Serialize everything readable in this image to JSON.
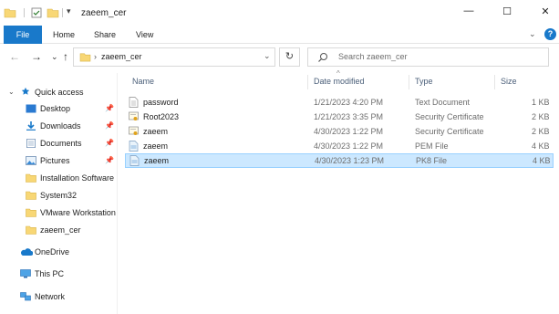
{
  "window": {
    "title": "zaeem_cer",
    "controls": {
      "minimize": "—",
      "maximize": "☐",
      "close": "✕"
    }
  },
  "ribbon": {
    "tabs": [
      "File",
      "Home",
      "Share",
      "View"
    ],
    "help": "?"
  },
  "navigation": {
    "back": "←",
    "forward": "→",
    "recent": "⌄",
    "up": "↑",
    "breadcrumb_sep": "›",
    "address": "zaeem_cer",
    "address_dropdown": "⌄",
    "refresh": "↻",
    "search_placeholder": "Search zaeem_cer"
  },
  "sidebar": {
    "quick_access": "Quick access",
    "items": [
      {
        "label": "Desktop",
        "icon": "desktop-icon",
        "pinned": true
      },
      {
        "label": "Downloads",
        "icon": "download-icon",
        "pinned": true
      },
      {
        "label": "Documents",
        "icon": "documents-icon",
        "pinned": true
      },
      {
        "label": "Pictures",
        "icon": "pictures-icon",
        "pinned": true
      },
      {
        "label": "Installation Software",
        "icon": "folder-icon",
        "pinned": false
      },
      {
        "label": "System32",
        "icon": "folder-icon",
        "pinned": false
      },
      {
        "label": "VMware Workstation",
        "icon": "folder-icon",
        "pinned": false
      },
      {
        "label": "zaeem_cer",
        "icon": "folder-icon",
        "pinned": false
      }
    ],
    "onedrive": "OneDrive",
    "this_pc": "This PC",
    "network": "Network"
  },
  "file_list": {
    "columns": [
      "Name",
      "Date modified",
      "Type",
      "Size"
    ],
    "sort_indicator": "^",
    "rows": [
      {
        "name": "password",
        "date": "1/21/2023 4:20 PM",
        "type": "Text Document",
        "size": "1 KB",
        "icon": "text-file-icon"
      },
      {
        "name": "Root2023",
        "date": "1/21/2023 3:35 PM",
        "type": "Security Certificate",
        "size": "2 KB",
        "icon": "certificate-icon"
      },
      {
        "name": "zaeem",
        "date": "4/30/2023 1:22 PM",
        "type": "Security Certificate",
        "size": "2 KB",
        "icon": "certificate-icon"
      },
      {
        "name": "zaeem",
        "date": "4/30/2023 1:22 PM",
        "type": "PEM File",
        "size": "4 KB",
        "icon": "pem-file-icon"
      },
      {
        "name": "zaeem",
        "date": "4/30/2023 1:23 PM",
        "type": "PK8 File",
        "size": "4 KB",
        "icon": "pk8-file-icon",
        "selected": true
      }
    ]
  },
  "colors": {
    "accent": "#1979ca",
    "selection": "#cce8ff",
    "folder": "#f8d775"
  }
}
